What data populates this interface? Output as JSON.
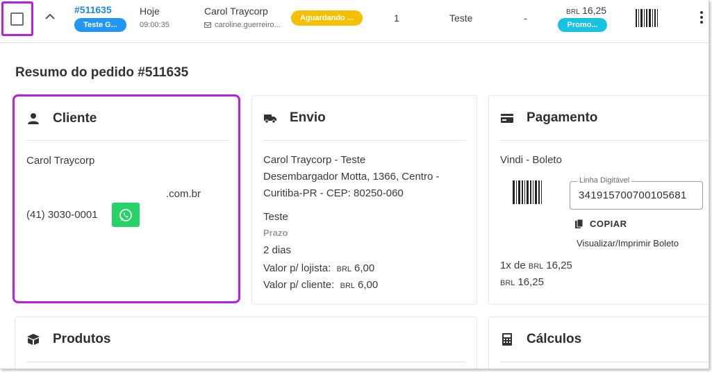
{
  "order": {
    "id": "#511635",
    "tag": "Teste G...",
    "date": "Hoje",
    "time": "09:00:35",
    "customer_name": "Carol Traycorp",
    "customer_email": "caroline.guerreiro...",
    "status": "Aguardando ...",
    "quantity": "1",
    "shipping": "Teste",
    "dash": "-",
    "currency": "BRL",
    "total": "16,25",
    "promo": "Promo..."
  },
  "summary": {
    "title": "Resumo do pedido #511635"
  },
  "cliente": {
    "title": "Cliente",
    "name": "Carol Traycorp",
    "email_suffix": ".com.br",
    "phone": "(41) 3030-0001"
  },
  "envio": {
    "title": "Envio",
    "address_line1": "Carol Traycorp - Teste",
    "address_line2": "Desembargador Motta, 1366, Centro -",
    "address_line3": "Curitiba-PR - CEP: 80250-060",
    "method": "Teste",
    "prazo_label": "Prazo",
    "prazo_value": "2 dias",
    "lojista_label": "Valor p/ lojista:",
    "lojista_currency": "BRL",
    "lojista_value": "6,00",
    "cliente_label": "Valor p/ cliente:",
    "cliente_currency": "BRL",
    "cliente_value": "6,00"
  },
  "pagamento": {
    "title": "Pagamento",
    "method": "Vindi - Boleto",
    "linha_label": "Linha Digitável",
    "linha_value": "341915700700105681",
    "copy_label": "COPIAR",
    "boleto_link": "Visualizar/Imprimir Boleto",
    "installments_prefix": "1x de",
    "installments_currency": "BRL",
    "installments_value": "16,25",
    "total_currency": "BRL",
    "total_value": "16,25"
  },
  "produtos": {
    "title": "Produtos"
  },
  "calculos": {
    "title": "Cálculos"
  },
  "colors": {
    "highlight": "#b620e0",
    "link_blue": "#1e88e5",
    "tag_blue": "#2196f3",
    "status_yellow": "#f5c000",
    "promo_cyan": "#17c3e0",
    "whatsapp_green": "#25d366"
  },
  "icons": {
    "chevron": "chevron-up-icon",
    "mail": "mail-icon",
    "barcode": "barcode-icon",
    "menu": "more-vertical-icon",
    "cliente": "person-icon",
    "envio": "truck-icon",
    "pagamento": "credit-card-icon",
    "whatsapp": "whatsapp-icon",
    "copy": "copy-icon",
    "produtos": "box-icon",
    "calculos": "calculator-icon"
  }
}
